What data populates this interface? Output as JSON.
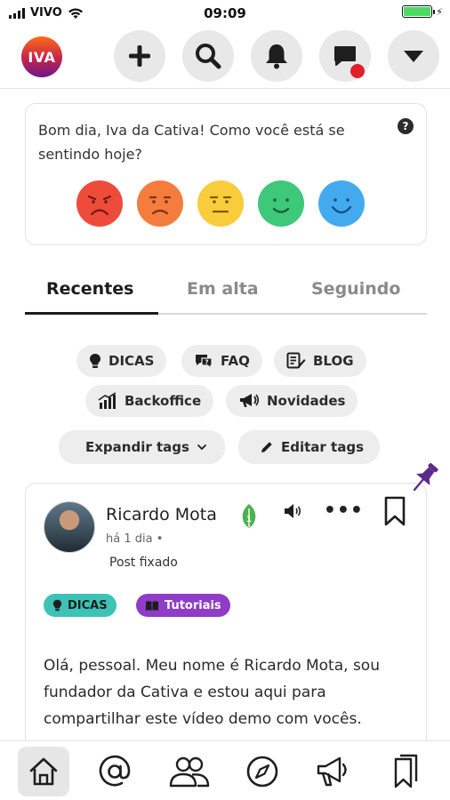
{
  "status_bar": {
    "carrier": "VIVO",
    "time": "09:09",
    "battery_level": 1.0,
    "battery_color": "#4cd964"
  },
  "header": {
    "avatar_text": "IVA",
    "buttons": [
      "plus-icon",
      "search-icon",
      "bell-icon",
      "chat-icon",
      "chevron-down-icon"
    ],
    "notification_dot_color": "#e0202a"
  },
  "mood_card": {
    "prompt": "Bom dia, Iva da Cativa! Como você está se sentindo hoje?",
    "help_label": "?",
    "faces": [
      {
        "name": "very-sad",
        "color": "#ef4b3a"
      },
      {
        "name": "sad",
        "color": "#f47c3c"
      },
      {
        "name": "neutral",
        "color": "#f9cc3b"
      },
      {
        "name": "happy",
        "color": "#3ec87a"
      },
      {
        "name": "very-happy",
        "color": "#44aaf0"
      }
    ]
  },
  "tabs": [
    {
      "label": "Recentes",
      "active": true
    },
    {
      "label": "Em alta",
      "active": false
    },
    {
      "label": "Seguindo",
      "active": false
    }
  ],
  "tags": {
    "dicas": "DICAS",
    "faq": "FAQ",
    "blog": "BLOG",
    "backoffice": "Backoffice",
    "novidades": "Novidades",
    "expand": "Expandir tags",
    "edit": "Editar tags"
  },
  "post": {
    "author": "Ricardo Mota",
    "time": "há 1 dia •",
    "pinned_label": "Post fixado",
    "more_label": "•••",
    "tags": [
      {
        "label": "DICAS",
        "color": "#3cc3b5"
      },
      {
        "label": "Tutoriais",
        "color": "#8f3cc8"
      }
    ],
    "body": "Olá, pessoal. Meu nome é Ricardo Mota, sou fundador da Cativa e estou aqui para compartilhar este vídeo demo com vocês."
  },
  "bottom_nav": {
    "items": [
      "home-icon",
      "mention-icon",
      "people-icon",
      "compass-icon",
      "megaphone-icon",
      "bookmark-icon"
    ],
    "active": "home-icon"
  },
  "colors": {
    "pin": "#5b2a8c",
    "accent_dark": "#1c1c1c"
  }
}
